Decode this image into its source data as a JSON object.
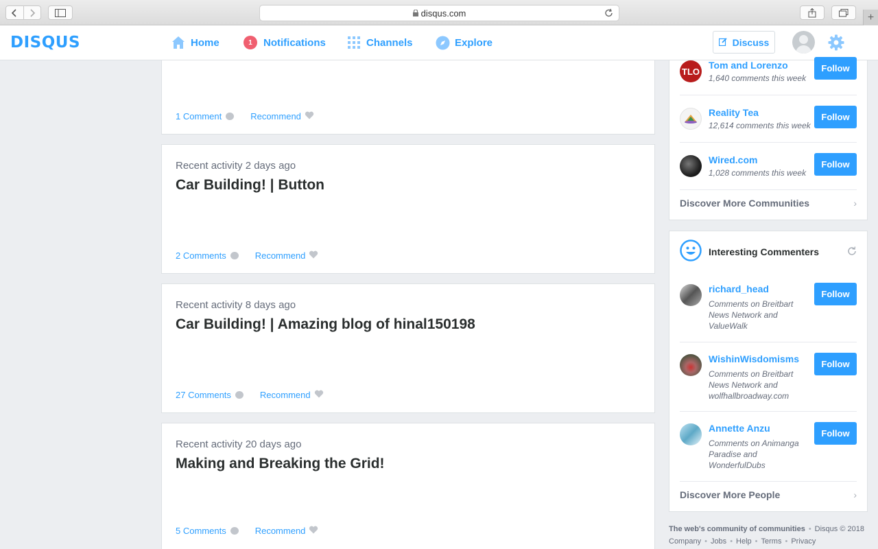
{
  "browser": {
    "url": "disqus.com"
  },
  "nav": {
    "logo": "DISQUS",
    "home": "Home",
    "notifications_count": "1",
    "notifications": "Notifications",
    "channels": "Channels",
    "explore": "Explore",
    "discuss": "Discuss"
  },
  "feed": [
    {
      "activity": "",
      "title": "",
      "comments": "1 Comment",
      "recommend": "Recommend"
    },
    {
      "activity": "Recent activity 2 days ago",
      "title": "Car Building! | Button",
      "comments": "2 Comments",
      "recommend": "Recommend"
    },
    {
      "activity": "Recent activity 8 days ago",
      "title": "Car Building! | Amazing blog of hinal150198",
      "comments": "27 Comments",
      "recommend": "Recommend"
    },
    {
      "activity": "Recent activity 20 days ago",
      "title": "Making and Breaking the Grid!",
      "comments": "5 Comments",
      "recommend": "Recommend"
    }
  ],
  "communities": {
    "items": [
      {
        "name": "Tom and Lorenzo",
        "meta": "1,640 comments this week",
        "follow": "Follow",
        "avatar_text": "TLO"
      },
      {
        "name": "Reality Tea",
        "meta": "12,614 comments this week",
        "follow": "Follow"
      },
      {
        "name": "Wired.com",
        "meta": "1,028 comments this week",
        "follow": "Follow"
      }
    ],
    "discover": "Discover More Communities"
  },
  "commenters": {
    "heading": "Interesting Commenters",
    "items": [
      {
        "name": "richard_head",
        "meta": "Comments on Breitbart News Network and ValueWalk",
        "follow": "Follow"
      },
      {
        "name": "WishinWisdomisms",
        "meta": "Comments on Breitbart News Network and wolfhallbroadway.com",
        "follow": "Follow"
      },
      {
        "name": "Annette Anzu",
        "meta": "Comments on Animanga Paradise and WonderfulDubs",
        "follow": "Follow"
      }
    ],
    "discover": "Discover More People"
  },
  "footer": {
    "tagline": "The web's community of communities",
    "copyright": "Disqus © 2018",
    "links": [
      "Company",
      "Jobs",
      "Help",
      "Terms",
      "Privacy"
    ]
  },
  "colors": {
    "accent": "#2e9fff",
    "badge": "#f05f70",
    "background": "#eceef1"
  }
}
